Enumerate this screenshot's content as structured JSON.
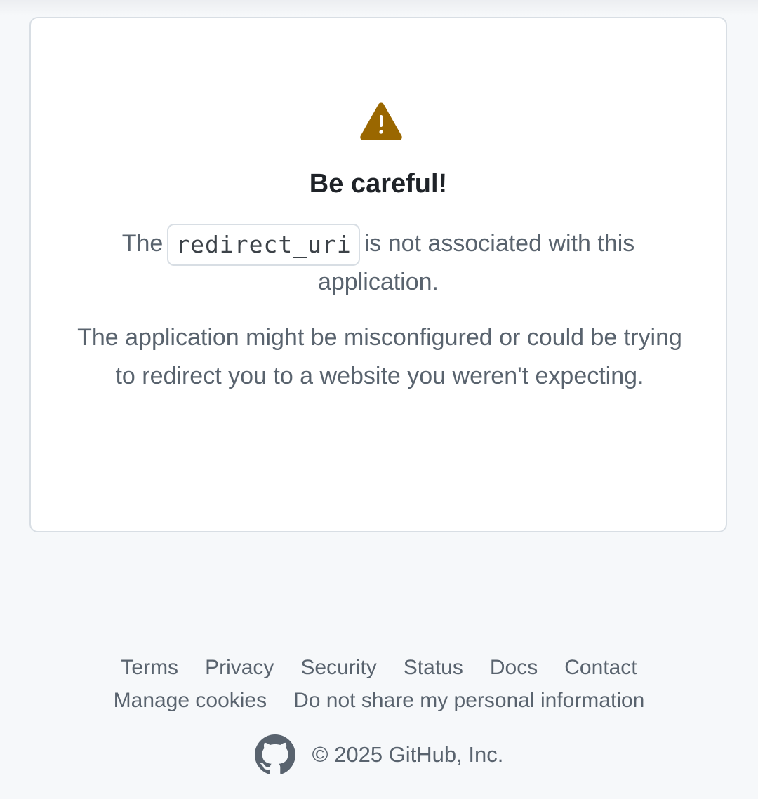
{
  "card": {
    "title": "Be careful!",
    "line1_before": "The",
    "code": "redirect_uri",
    "line1_after": "is not associated with this",
    "line2": "application.",
    "paragraph2": "The application might be misconfigured or could be trying to redirect you to a website you weren't expecting.",
    "icon": "alert-icon",
    "icon_color": "#9a6700"
  },
  "footer": {
    "links_row1": [
      "Terms",
      "Privacy",
      "Security",
      "Status",
      "Docs",
      "Contact"
    ],
    "links_row2": [
      "Manage cookies",
      "Do not share my personal information"
    ],
    "logo": "github-mark-icon",
    "copyright": "© 2025 GitHub, Inc."
  },
  "colors": {
    "background": "#f6f8fa",
    "card_border": "#d8dee4",
    "muted_text": "#59636e"
  }
}
